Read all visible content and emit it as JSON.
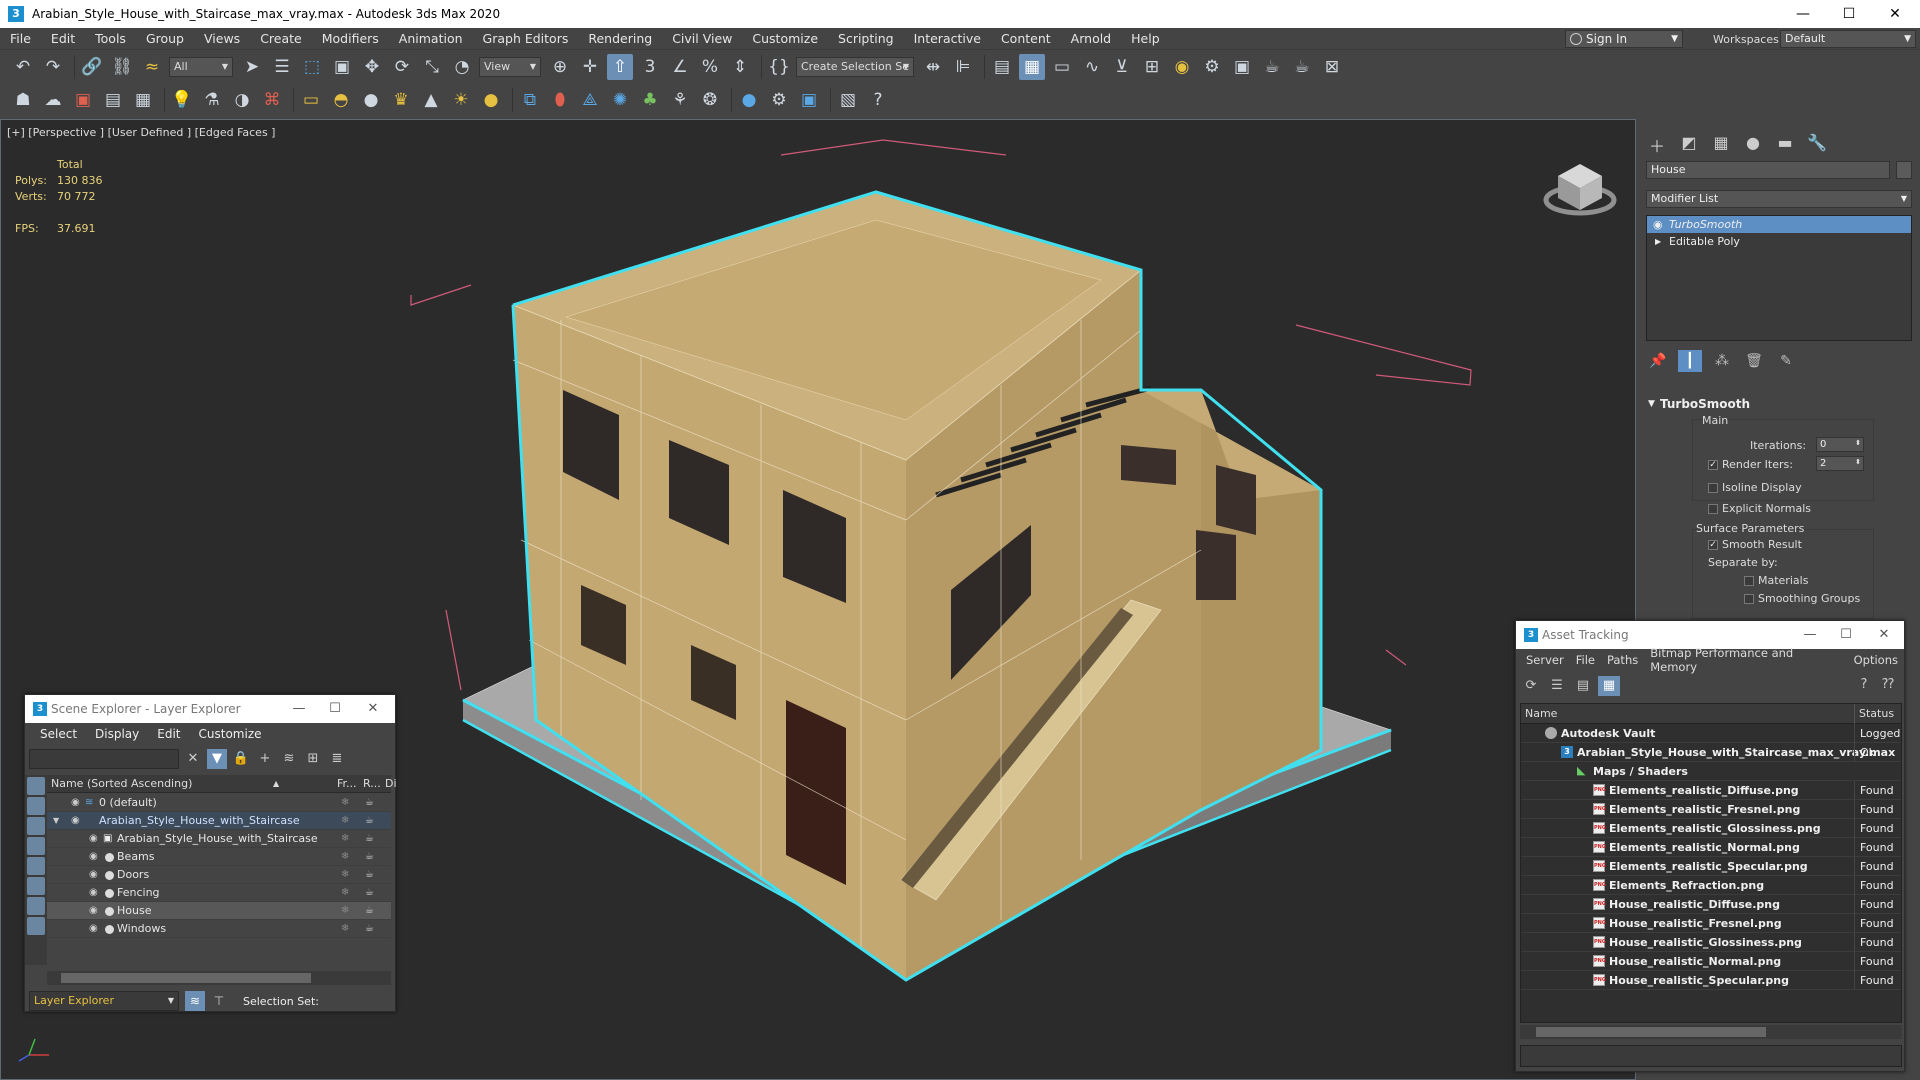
{
  "window": {
    "title": "Arabian_Style_House_with_Staircase_max_vray.max - Autodesk 3ds Max 2020",
    "minimize": "—",
    "maximize": "☐",
    "close": "✕"
  },
  "menu": {
    "items": [
      {
        "label": "File",
        "key": "File"
      },
      {
        "label": "Edit",
        "key": "Edit"
      },
      {
        "label": "Tools",
        "key": "Tools"
      },
      {
        "label": "Group",
        "key": "Group"
      },
      {
        "label": "Views",
        "key": "Views"
      },
      {
        "label": "Create",
        "key": "Create"
      },
      {
        "label": "Modifiers",
        "key": "Modifiers"
      },
      {
        "label": "Animation",
        "key": "Animation"
      },
      {
        "label": "Graph Editors",
        "key": "Graph Editors"
      },
      {
        "label": "Rendering",
        "key": "Rendering"
      },
      {
        "label": "Civil View",
        "key": "Civil View"
      },
      {
        "label": "Customize",
        "key": "Customize"
      },
      {
        "label": "Scripting",
        "key": "Scripting"
      },
      {
        "label": "Interactive",
        "key": "Interactive"
      },
      {
        "label": "Content",
        "key": "Content"
      },
      {
        "label": "Arnold",
        "key": "Arnold"
      },
      {
        "label": "Help",
        "key": "Help"
      }
    ],
    "sign_in": "Sign In",
    "workspaces_label": "Workspaces:",
    "workspace": "Default"
  },
  "toolbar": {
    "selection_filter": "All",
    "ref_coord": "View",
    "selection_set": "Create Selection Se"
  },
  "viewport": {
    "label": "[+] [Perspective ] [User Defined ] [Edged Faces ]",
    "stats": {
      "total_label": "Total",
      "polys_label": "Polys:",
      "polys": "130 836",
      "verts_label": "Verts:",
      "verts": "70 772",
      "fps_label": "FPS:",
      "fps": "37.691"
    }
  },
  "command_panel": {
    "object_name": "House",
    "modifier_list": "Modifier List",
    "stack": [
      {
        "label": "TurboSmooth",
        "selected": true
      },
      {
        "label": "Editable Poly",
        "selected": false
      }
    ],
    "rollout": {
      "title": "TurboSmooth",
      "main": "Main",
      "iterations_label": "Iterations:",
      "iterations": "0",
      "render_iters_label": "Render Iters:",
      "render_iters": "2",
      "isoline": "Isoline Display",
      "explicit_normals": "Explicit Normals",
      "surface_params": "Surface Parameters",
      "smooth_result": "Smooth Result",
      "separate_by": "Separate by:",
      "materials": "Materials",
      "smoothing_groups": "Smoothing Groups"
    }
  },
  "scene_explorer": {
    "title": "Scene Explorer - Layer Explorer",
    "menu": [
      "Select",
      "Display",
      "Edit",
      "Customize"
    ],
    "col_name": "Name (Sorted Ascending)",
    "col_fr": "Fr...",
    "col_r": "R...",
    "col_di": "Di",
    "rows": [
      {
        "label": "0 (default)",
        "indent": 0
      },
      {
        "label": "Arabian_Style_House_with_Staircase",
        "indent": 0
      },
      {
        "label": "Arabian_Style_House_with_Staircase",
        "indent": 1
      },
      {
        "label": "Beams",
        "indent": 1
      },
      {
        "label": "Doors",
        "indent": 1
      },
      {
        "label": "Fencing",
        "indent": 1
      },
      {
        "label": "House",
        "indent": 1
      },
      {
        "label": "Windows",
        "indent": 1
      }
    ],
    "layer_explorer": "Layer Explorer",
    "selection_set": "Selection Set:"
  },
  "asset_tracking": {
    "title": "Asset Tracking",
    "menu": [
      "Server",
      "File",
      "Paths",
      "Bitmap Performance and Memory",
      "Options"
    ],
    "col_name": "Name",
    "col_status": "Status",
    "rows": [
      {
        "name": "Autodesk Vault",
        "status": "Logged C",
        "type": "vault",
        "indent": 0
      },
      {
        "name": "Arabian_Style_House_with_Staircase_max_vray.max",
        "status": "Ok",
        "type": "max",
        "indent": 1
      },
      {
        "name": "Maps / Shaders",
        "status": "",
        "type": "maps",
        "indent": 2
      },
      {
        "name": "Elements_realistic_Diffuse.png",
        "status": "Found",
        "type": "png",
        "indent": 3
      },
      {
        "name": "Elements_realistic_Fresnel.png",
        "status": "Found",
        "type": "png",
        "indent": 3
      },
      {
        "name": "Elements_realistic_Glossiness.png",
        "status": "Found",
        "type": "png",
        "indent": 3
      },
      {
        "name": "Elements_realistic_Normal.png",
        "status": "Found",
        "type": "png",
        "indent": 3
      },
      {
        "name": "Elements_realistic_Specular.png",
        "status": "Found",
        "type": "png",
        "indent": 3
      },
      {
        "name": "Elements_Refraction.png",
        "status": "Found",
        "type": "png",
        "indent": 3
      },
      {
        "name": "House_realistic_Diffuse.png",
        "status": "Found",
        "type": "png",
        "indent": 3
      },
      {
        "name": "House_realistic_Fresnel.png",
        "status": "Found",
        "type": "png",
        "indent": 3
      },
      {
        "name": "House_realistic_Glossiness.png",
        "status": "Found",
        "type": "png",
        "indent": 3
      },
      {
        "name": "House_realistic_Normal.png",
        "status": "Found",
        "type": "png",
        "indent": 3
      },
      {
        "name": "House_realistic_Specular.png",
        "status": "Found",
        "type": "png",
        "indent": 3
      }
    ]
  },
  "colors": {
    "accent": "#5d8ec4",
    "selection_outline": "#40e0f0",
    "wall": "#c9b07a",
    "stats_text": "#e8d27a"
  }
}
